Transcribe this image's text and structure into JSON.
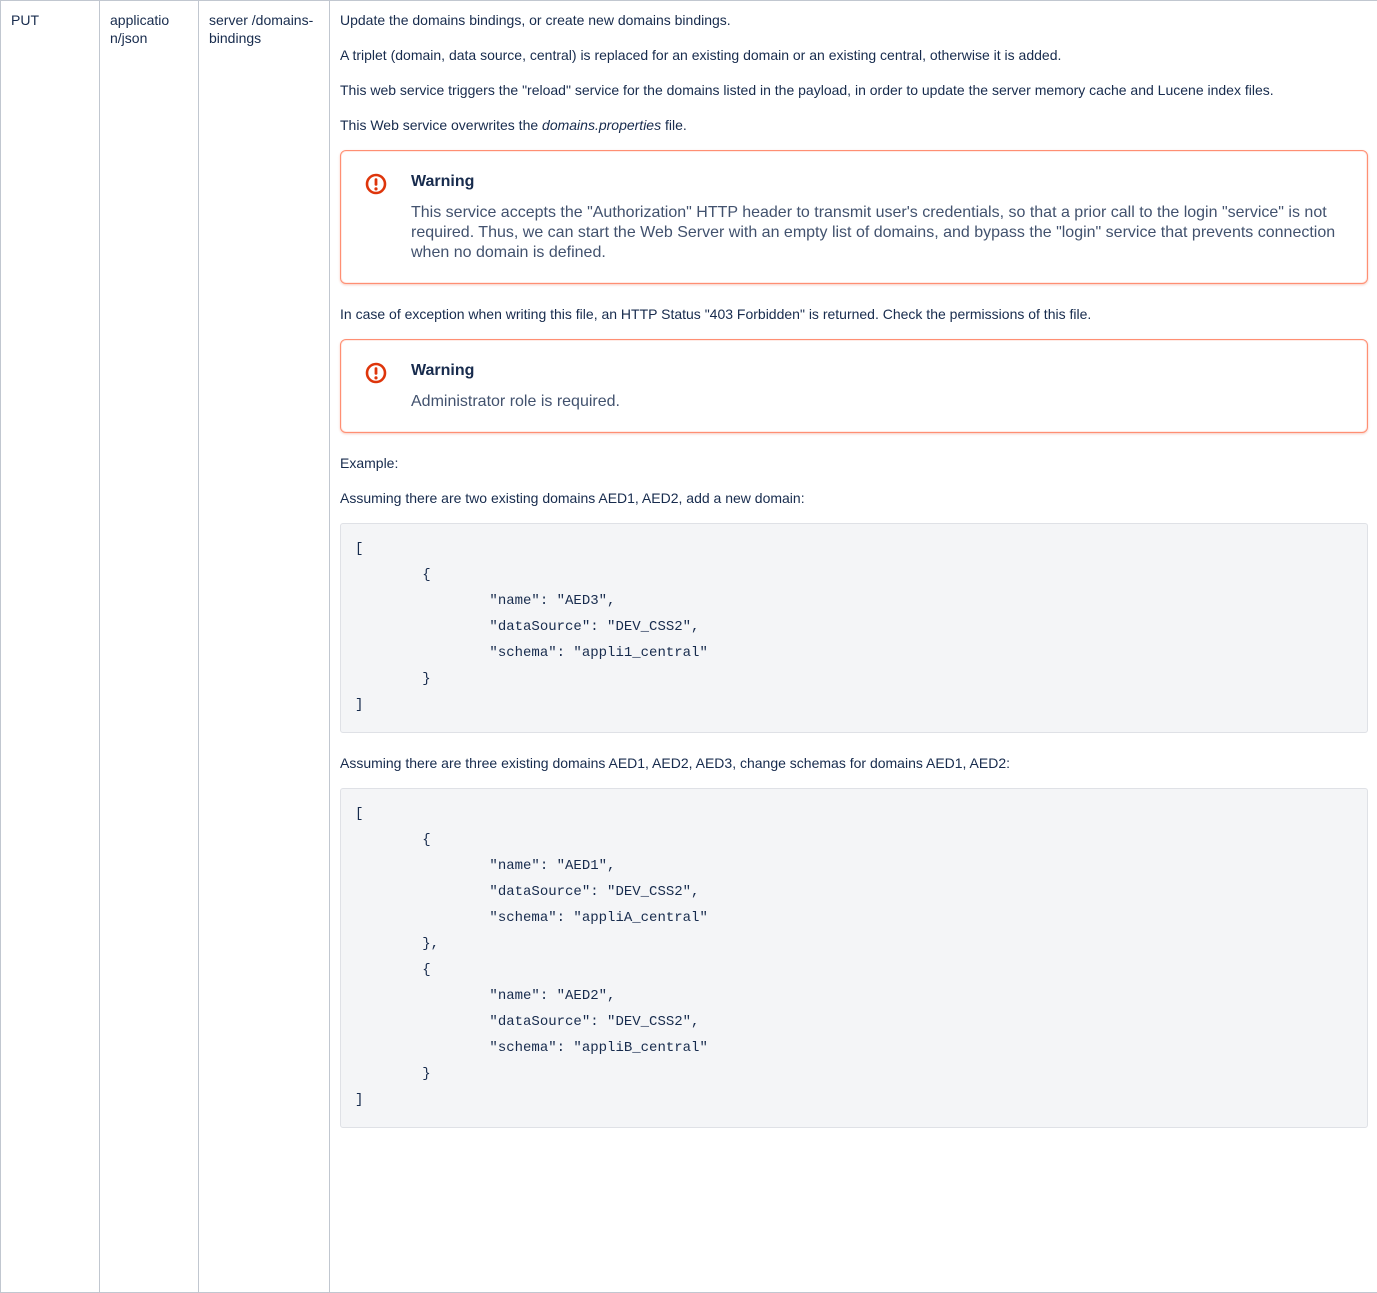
{
  "row": {
    "method": "PUT",
    "content_type": "applicatio n/json",
    "path": "server /domains- bindings"
  },
  "description": {
    "intro": "Update the domains bindings, or create new domains bindings.",
    "triplet": "A triplet (domain, data source, central) is replaced for an existing domain or an existing central, otherwise it is added.",
    "reload": "This web service triggers the \"reload\" service for the domains listed in the payload, in order to update the server memory cache and Lucene index files.",
    "overwrite_prefix": "This Web service overwrites the ",
    "overwrite_file": "domains.properties",
    "overwrite_suffix": " file.",
    "exception": "In case of exception when writing this file, an HTTP Status \"403 Forbidden\" is returned. Check the permissions of this file.",
    "example_label": "Example:",
    "example1_intro": "Assuming there are two existing domains AED1, AED2, add a new domain:",
    "example2_intro": "Assuming there are three existing domains AED1, AED2, AED3, change schemas for domains AED1, AED2:"
  },
  "warnings": [
    {
      "icon": "exclamation-circle-icon",
      "title": "Warning",
      "body": "This service accepts the \"Authorization\" HTTP header to transmit user's credentials, so that a prior call to the login \"service\" is not required. Thus, we can start the Web Server with an empty list of domains, and bypass the \"login\" service that prevents connection when no domain is defined."
    },
    {
      "icon": "exclamation-circle-icon",
      "title": "Warning",
      "body": "Administrator role is required."
    }
  ],
  "code_blocks": [
    "[\n\t{\n\t\t\"name\": \"AED3\",\n\t\t\"dataSource\": \"DEV_CSS2\",\n\t\t\"schema\": \"appli1_central\"\n\t}\n]",
    "[\n\t{\n\t\t\"name\": \"AED1\",\n\t\t\"dataSource\": \"DEV_CSS2\",\n\t\t\"schema\": \"appliA_central\"\n\t},\n\t{\n\t\t\"name\": \"AED2\",\n\t\t\"dataSource\": \"DEV_CSS2\",\n\t\t\"schema\": \"appliB_central\"\n\t}\n]"
  ],
  "colors": {
    "border": "#c1c7d0",
    "warning_border": "#ff8f73",
    "warning_icon": "#de350b",
    "code_bg": "#f4f5f7"
  }
}
